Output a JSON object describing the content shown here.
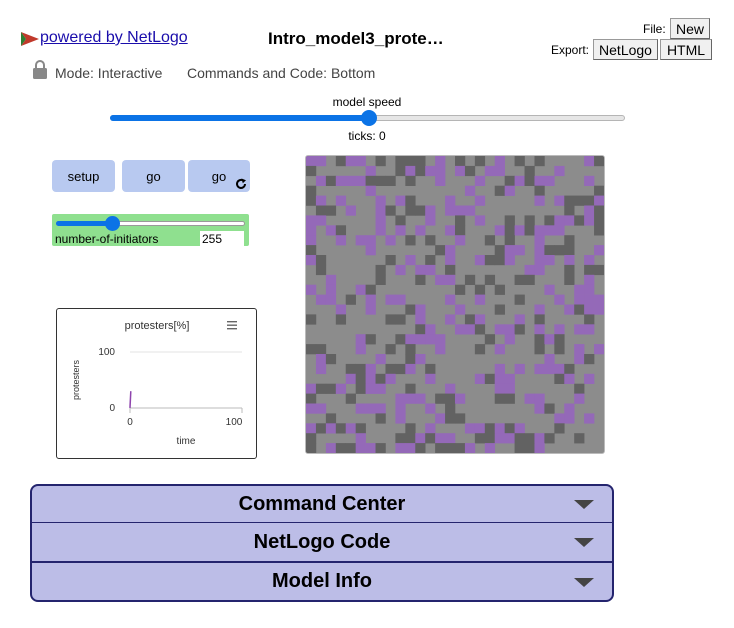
{
  "header": {
    "powered_text": " powered by NetLogo",
    "model_title": "Intro_model3_prote…",
    "file_label": "File:",
    "new_button": "New",
    "export_label": "Export:",
    "export_netlogo": "NetLogo",
    "export_html": "HTML",
    "mode_text": "Mode: Interactive",
    "commands_text": "Commands and Code: Bottom"
  },
  "speed": {
    "label": "model speed",
    "ticks_text": "ticks: 0",
    "value_fraction": 0.5
  },
  "buttons": {
    "setup": "setup",
    "go": "go",
    "go_forever": "go"
  },
  "slider": {
    "name": "number-of-initiators",
    "value": "255",
    "fraction": 0.3
  },
  "plot": {
    "title": "protesters[%]",
    "ylabel": "protesters",
    "xlabel": "time",
    "ymax_label": "100",
    "ymin_label": "0",
    "xmin_label": "0",
    "xmax_label": "100",
    "menu_icon": "hamburger-menu-icon"
  },
  "chart_data": {
    "type": "line",
    "title": "protesters[%]",
    "xlabel": "time",
    "ylabel": "protesters",
    "xlim": [
      0,
      100
    ],
    "ylim": [
      0,
      100
    ],
    "series": [
      {
        "color": "#8e44ad",
        "x": [
          0,
          0,
          0
        ],
        "y": [
          0,
          30,
          2
        ]
      }
    ]
  },
  "view": {
    "colors": {
      "bg": "#8c8c8c",
      "dark": "#626262",
      "purple": "#9469b8"
    },
    "patch_counts": {
      "cols": 30,
      "rows": 30
    }
  },
  "accordions": [
    {
      "label": "Command Center"
    },
    {
      "label": "NetLogo Code"
    },
    {
      "label": "Model Info"
    }
  ]
}
